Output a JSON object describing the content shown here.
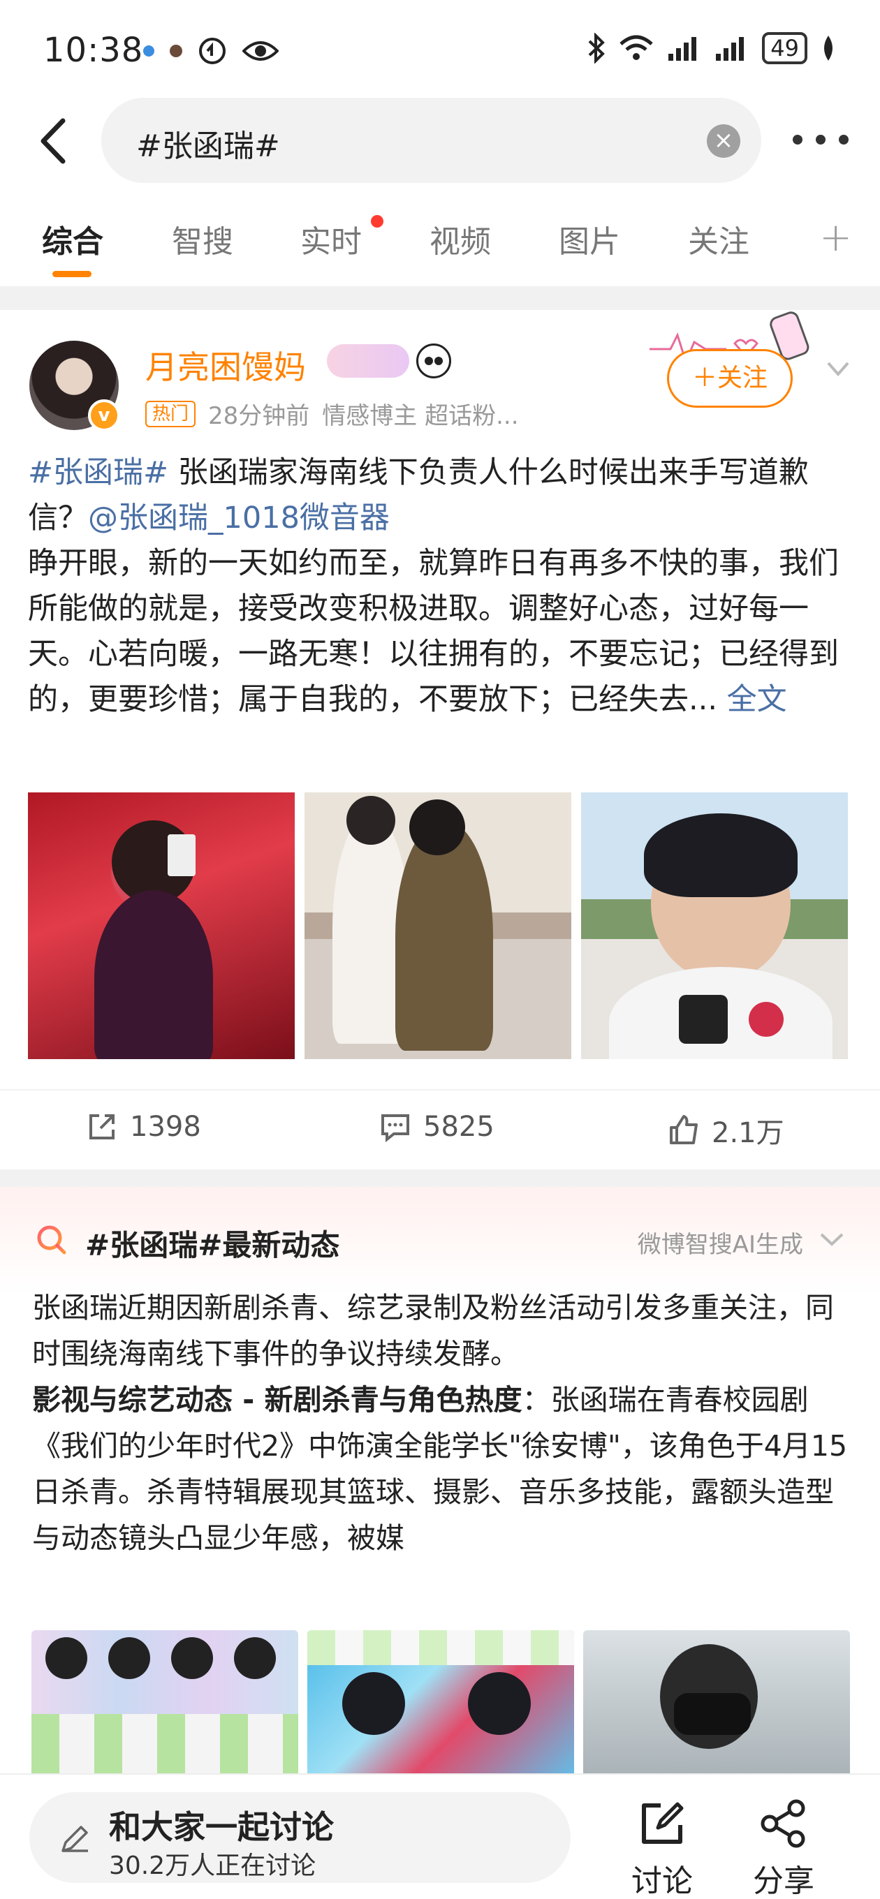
{
  "status_bar": {
    "time": "10:38",
    "battery": "49"
  },
  "search": {
    "query": "#张函瑞#",
    "clear": "×"
  },
  "tabs": [
    {
      "label": "综合",
      "active": true
    },
    {
      "label": "智搜"
    },
    {
      "label": "实时",
      "dot": true
    },
    {
      "label": "视频"
    },
    {
      "label": "图片"
    },
    {
      "label": "关注"
    }
  ],
  "tab_add": "+",
  "post": {
    "username": "月亮困馒妈",
    "fan_badge": "",
    "tag": "热门",
    "time": "28分钟前",
    "role": "情感博主 超话粉...",
    "follow": "＋关注",
    "hashtag": "#张函瑞#",
    "title": " 张函瑞家海南线下负责人什么时候出来手写道歉信？",
    "mention": "@张函瑞_1018微音器",
    "body": "睁开眼，新的一天如约而至，就算昨日有再多不快的事，我们所能做的就是，接受改变积极进取。调整好心态，过好每一天。心若向暖，一路无寒！以往拥有的，不要忘记；已经得到的，更要珍惜；属于自我的，不要放下；已经失去...",
    "more": " 全文",
    "reposts": "1398",
    "comments": "5825",
    "likes": "2.1万"
  },
  "ai_summary": {
    "title": "#张函瑞#最新动态",
    "source": "微博智搜AI生成",
    "intro": "张函瑞近期因新剧杀青、综艺录制及粉丝活动引发多重关注，同时围绕海南线下事件的争议持续发酵。",
    "section_title": "影视与综艺动态 - 新剧杀青与角色热度",
    "section_body": "：张函瑞在青春校园剧《我们的少年时代2》中饰演全能学长\"徐安博\"，该角色于4月15日杀青。杀青特辑展现其篮球、摄影、音乐多技能，露额头造型与动态镜头凸显少年感，被媒"
  },
  "bottom_bar": {
    "title": "和大家一起讨论",
    "subtitle": "30.2万人正在讨论",
    "discuss": "讨论",
    "share": "分享"
  },
  "colors": {
    "accent": "#ff8200",
    "link": "#4a6fa5"
  }
}
